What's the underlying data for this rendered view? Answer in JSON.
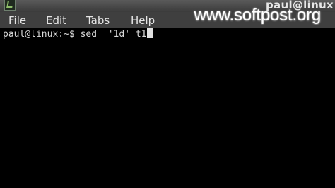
{
  "window": {
    "title": "paul@linux"
  },
  "menubar": {
    "items": [
      "File",
      "Edit",
      "Tabs",
      "Help"
    ]
  },
  "watermark": {
    "text": "www.softpost.org"
  },
  "terminal": {
    "prompt": "paul@linux:~$ ",
    "command": "sed  '1d' t1"
  }
}
